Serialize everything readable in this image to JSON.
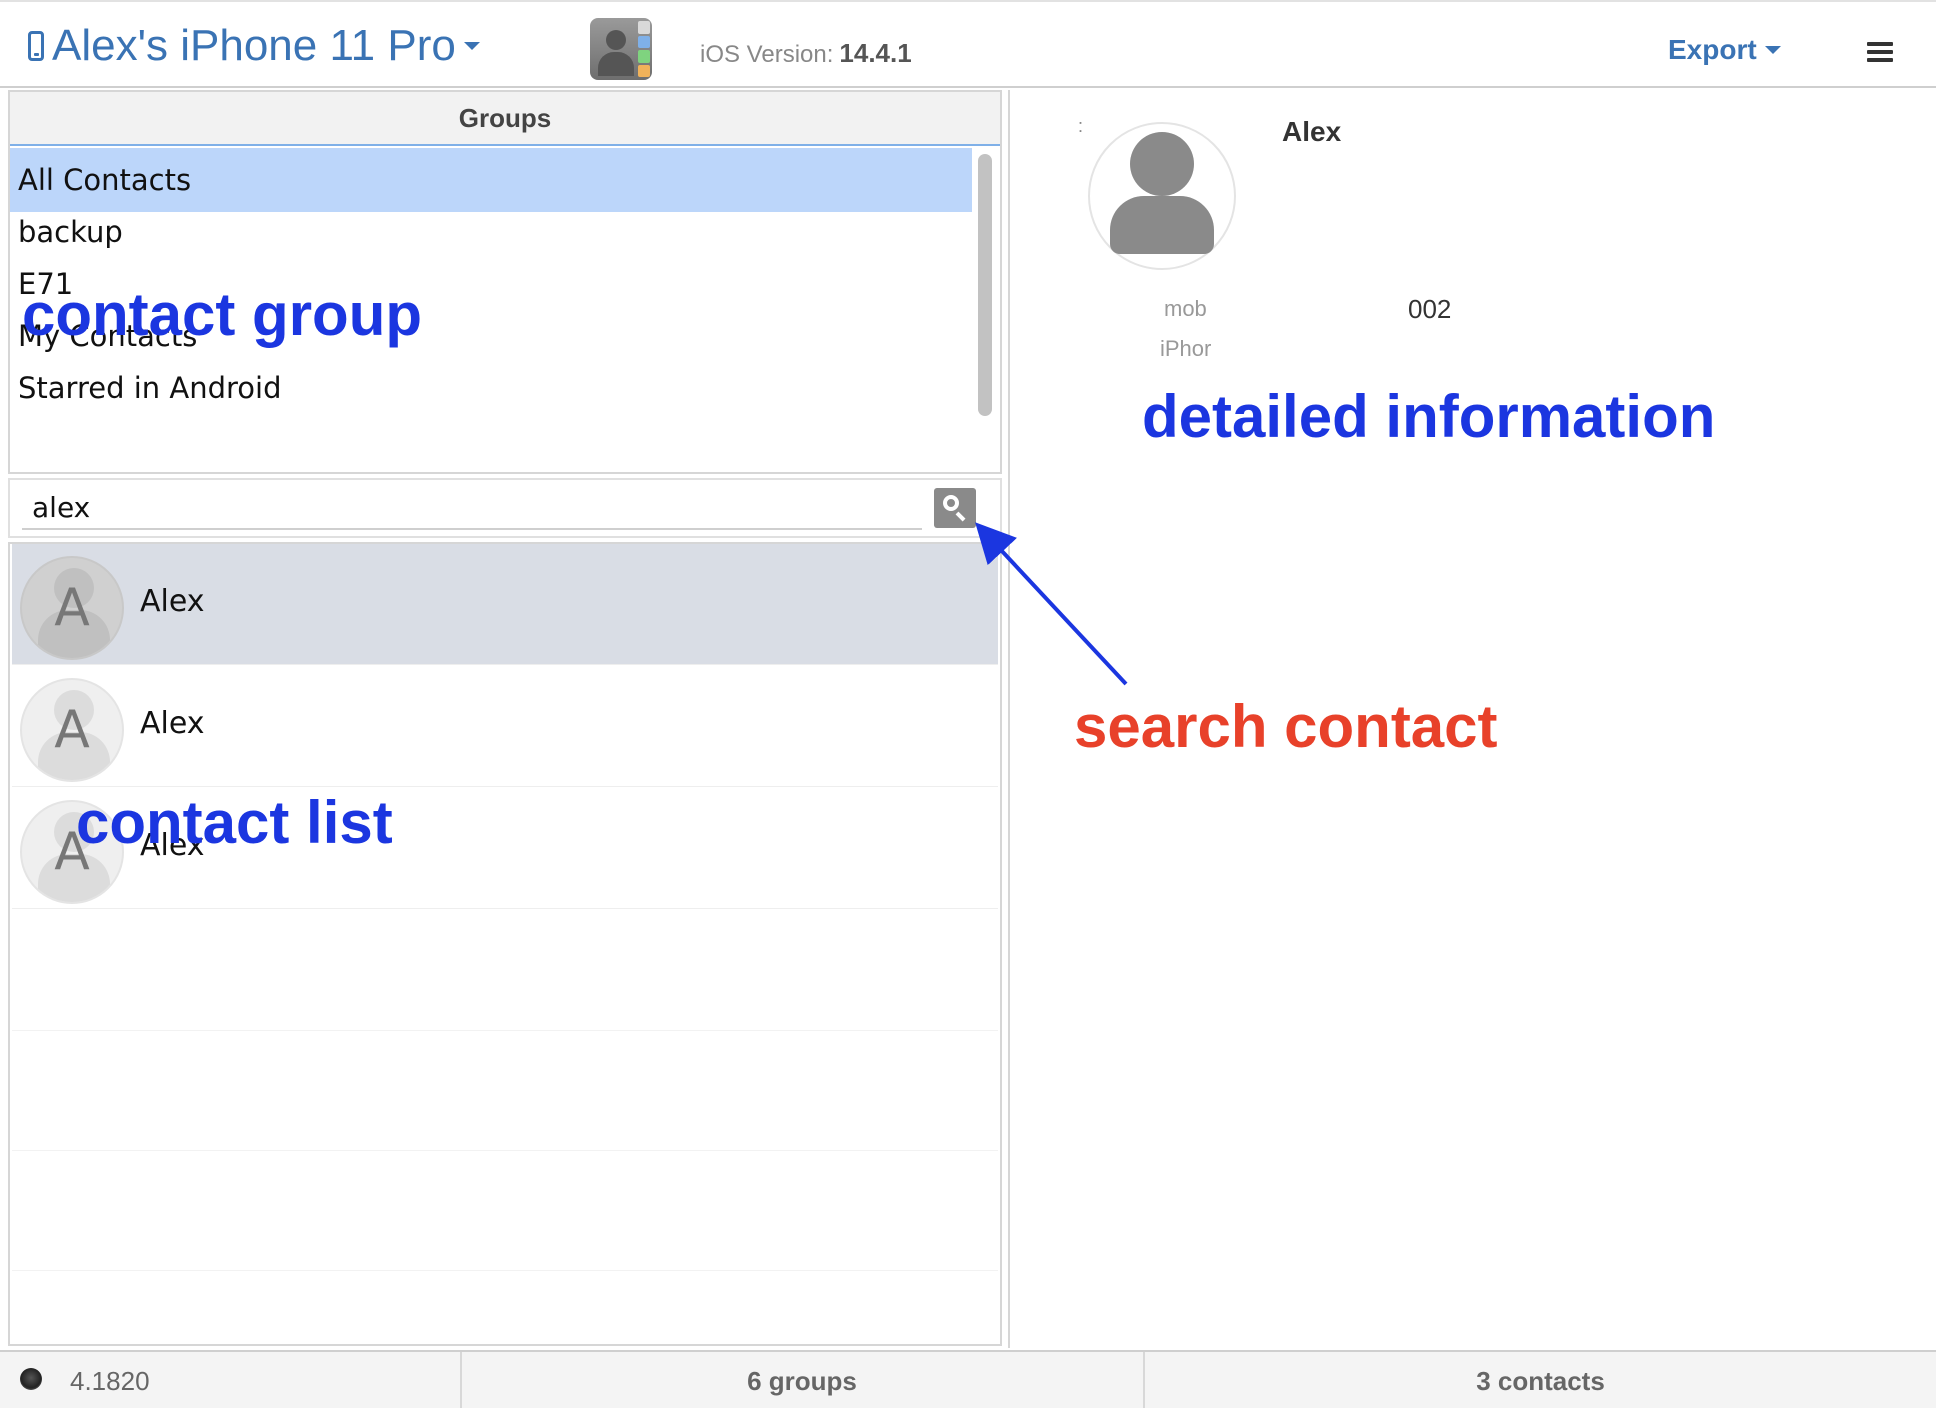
{
  "header": {
    "device_name": "Alex's iPhone 11 Pro",
    "ios_version_label": "iOS Version:",
    "ios_version_value": "14.4.1",
    "export_label": "Export"
  },
  "groups": {
    "title": "Groups",
    "items": [
      {
        "label": "All Contacts",
        "selected": true
      },
      {
        "label": "backup"
      },
      {
        "label": "E71"
      },
      {
        "label": "My Contacts"
      },
      {
        "label": "Starred in Android"
      }
    ]
  },
  "search": {
    "value": "alex"
  },
  "contacts": [
    {
      "initial": "A",
      "name": "Alex",
      "selected": true
    },
    {
      "initial": "A",
      "name": "Alex"
    },
    {
      "initial": "A",
      "name": "Alex"
    }
  ],
  "detail": {
    "colon": ":",
    "name": "Alex",
    "phone_label": "mob",
    "phone_value": "002",
    "phone_sublabel": "iPhor"
  },
  "status": {
    "version": "4.1820",
    "groups_count": "6 groups",
    "contacts_count": "3 contacts"
  },
  "annotations": {
    "contact_group": "contact group",
    "detailed_information": "detailed information",
    "search_contact": "search contact",
    "contact_list": "contact list"
  },
  "colors": {
    "accent": "#3a73b4",
    "selected_group": "#bcd6fa",
    "annotation_blue": "#1b36e0",
    "annotation_red": "#e8412a"
  },
  "icons": {
    "device": "phone-icon",
    "app": "contacts-app-icon",
    "menu": "hamburger-menu-icon",
    "search": "search-icon",
    "avatar": "person-silhouette-icon",
    "status": "connection-status-icon"
  }
}
